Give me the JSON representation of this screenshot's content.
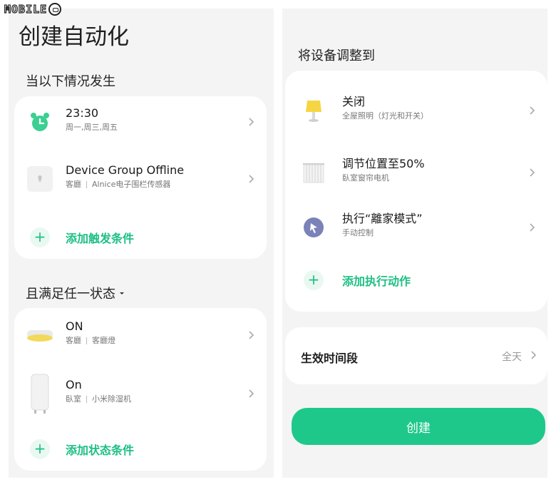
{
  "watermark": "MOBILE",
  "left": {
    "title": "创建自动化",
    "when_section": "当以下情况发生",
    "triggers": [
      {
        "main": "23:30",
        "sub1": "周一,周三,周五",
        "sub2": "",
        "icon": "alarm-clock-icon"
      },
      {
        "main": "Device Group Offline",
        "sub1": "客廳",
        "sub2": "Alnice电子围栏传感器",
        "icon": "sensor-icon"
      }
    ],
    "add_trigger": "添加触发条件",
    "condition_section": "且满足任一状态",
    "conditions": [
      {
        "main": "ON",
        "sub1": "客廳",
        "sub2": "客廳燈",
        "icon": "ceiling-lamp-icon"
      },
      {
        "main": "On",
        "sub1": "臥室",
        "sub2": "小米除湿机",
        "icon": "dehumidifier-icon"
      }
    ],
    "add_condition": "添加状态条件"
  },
  "right": {
    "section": "将设备调整到",
    "actions": [
      {
        "main": "关闭",
        "sub": "全屋照明（灯光和开关）",
        "icon": "table-lamp-icon"
      },
      {
        "main": "调节位置至50%",
        "sub": "臥室窗帘电机",
        "icon": "curtain-icon"
      },
      {
        "main": "执行“離家模式”",
        "sub": "手动控制",
        "icon": "manual-control-icon"
      }
    ],
    "add_action": "添加执行动作",
    "timeframe_label": "生效时间段",
    "timeframe_value": "全天",
    "create_label": "创建"
  },
  "colors": {
    "accent": "#1ec88b",
    "accent_text": "#1dbf85",
    "panel_bg": "#f4f4f4",
    "card_bg": "#ffffff"
  }
}
